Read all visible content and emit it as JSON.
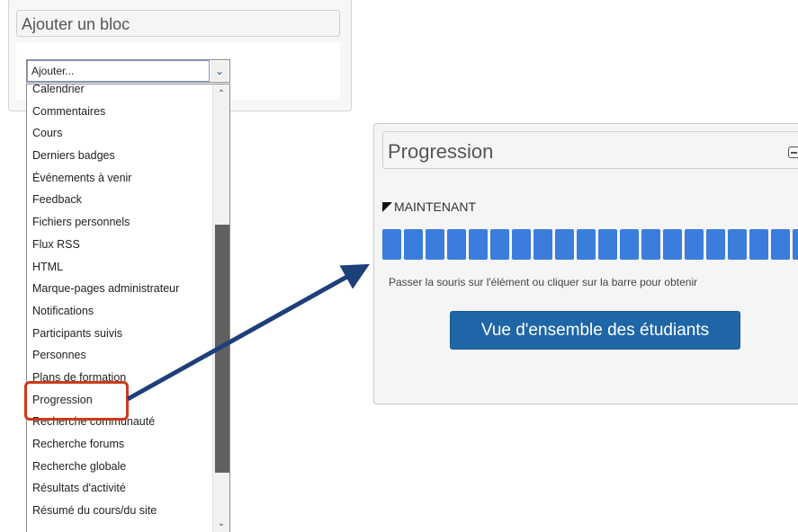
{
  "add_block": {
    "title": "Ajouter un bloc",
    "select_value": "Ajouter...",
    "options": [
      "Calendrier",
      "Commentaires",
      "Cours",
      "Derniers badges",
      "Événements à venir",
      "Feedback",
      "Fichiers personnels",
      "Flux RSS",
      "HTML",
      "Marque-pages administrateur",
      "Notifications",
      "Participants suivis",
      "Personnes",
      "Plans de formation",
      "Progression",
      "Recherche communauté",
      "Recherche forums",
      "Recherche globale",
      "Résultats d'activité",
      "Résumé du cours/du site"
    ],
    "highlighted_option": "Progression"
  },
  "progression_block": {
    "title": "Progression",
    "now_label": "MAINTENANT",
    "info_text": "Passer la souris sur l'élément ou cliquer sur la barre pour obtenir",
    "overview_button": "Vue d'ensemble des étudiants",
    "bar_cells": 20,
    "bar_color": "#3b7ddd"
  },
  "colors": {
    "highlight": "#cc3a1a",
    "arrow": "#1d3f7a",
    "button": "#1f66a6"
  },
  "icons": {
    "select_arrow": "chevron-down-icon",
    "collapse": "minus-square-icon",
    "scroll_up": "caret-up-icon",
    "scroll_down": "caret-down-icon",
    "now_marker": "triangle-marker-icon"
  }
}
